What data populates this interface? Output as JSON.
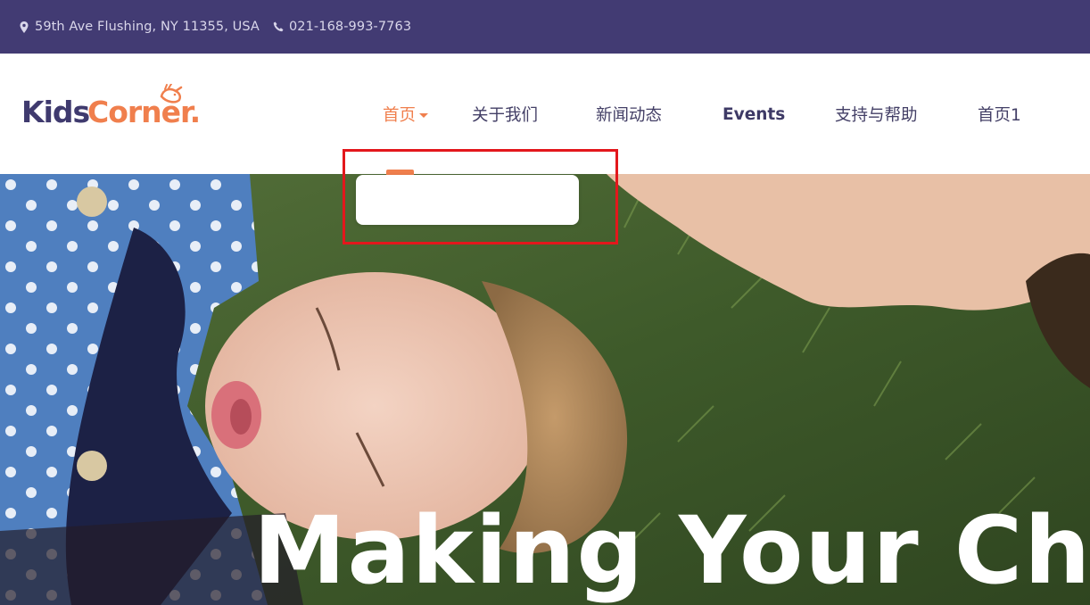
{
  "topbar": {
    "address": "59th Ave Flushing, NY 11355, USA",
    "phone": "021-168-993-7763",
    "address_icon": "map-marker-icon",
    "phone_icon": "phone-icon",
    "background": "#423b73"
  },
  "logo": {
    "part1": "Kids",
    "part2": "Corner.",
    "icon": "bird-icon"
  },
  "nav": {
    "items": [
      {
        "label": "首页"
      },
      {
        "label": "关于我们"
      },
      {
        "label": "新闻动态"
      },
      {
        "label": "Events"
      },
      {
        "label": "支持与帮助"
      },
      {
        "label": "首页1"
      }
    ],
    "active_color": "#f07f4d"
  },
  "hero": {
    "title": "Making Your Chilo"
  }
}
